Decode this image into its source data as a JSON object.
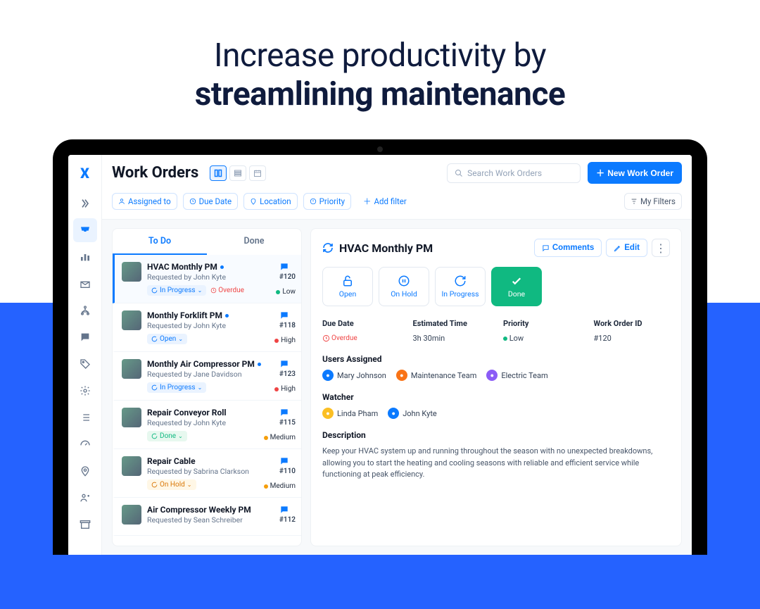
{
  "hero": {
    "line1": "Increase productivity by",
    "line2": "streamlining maintenance"
  },
  "header": {
    "title": "Work Orders",
    "search_placeholder": "Search Work Orders",
    "new_button": "New Work Order"
  },
  "filters": {
    "assigned": "Assigned to",
    "due": "Due Date",
    "location": "Location",
    "priority": "Priority",
    "add": "Add filter",
    "my": "My Filters"
  },
  "tabs": {
    "todo": "To Do",
    "done": "Done"
  },
  "work_orders": [
    {
      "title": "HVAC Monthly PM",
      "req": "Requested by John Kyte",
      "status": "In Progress",
      "status_class": "progress",
      "num": "#120",
      "prio": "Low",
      "prio_class": "prio-low",
      "overdue": true,
      "unread": true,
      "active": true
    },
    {
      "title": "Monthly Forklift PM",
      "req": "Requested by John Kyte",
      "status": "Open",
      "status_class": "open",
      "num": "#118",
      "prio": "High",
      "prio_class": "prio-high",
      "unread": true
    },
    {
      "title": "Monthly Air Compressor PM",
      "req": "Requested by Jane Davidson",
      "status": "In Progress",
      "status_class": "progress",
      "num": "#123",
      "prio": "High",
      "prio_class": "prio-high",
      "unread": true
    },
    {
      "title": "Repair Conveyor Roll",
      "req": "Requested by John Kyte",
      "status": "Done",
      "status_class": "done",
      "num": "#115",
      "prio": "Medium",
      "prio_class": "prio-med"
    },
    {
      "title": "Repair Cable",
      "req": "Requested by Sabrina Clarkson",
      "status": "On Hold",
      "status_class": "hold",
      "num": "#110",
      "prio": "Medium",
      "prio_class": "prio-med"
    },
    {
      "title": "Air Compressor Weekly PM",
      "req": "Requested by Sean Schreiber",
      "status": "",
      "status_class": "",
      "num": "#112",
      "prio": "",
      "prio_class": ""
    }
  ],
  "detail": {
    "title": "HVAC Monthly PM",
    "comments_btn": "Comments",
    "edit_btn": "Edit",
    "statuses": {
      "open": "Open",
      "hold": "On Hold",
      "progress": "In Progress",
      "done": "Done"
    },
    "labels": {
      "due": "Due Date",
      "est": "Estimated Time",
      "prio": "Priority",
      "id": "Work Order ID"
    },
    "values": {
      "due": "Overdue",
      "est": "3h 30min",
      "prio": "Low",
      "id": "#120"
    },
    "users_heading": "Users Assigned",
    "users": [
      {
        "name": "Mary Johnson",
        "cls": "av-blue"
      },
      {
        "name": "Maintenance Team",
        "cls": "av-orange"
      },
      {
        "name": "Electric Team",
        "cls": "av-purple"
      }
    ],
    "watcher_heading": "Watcher",
    "watchers": [
      {
        "name": "Linda Pham",
        "cls": "av-yellow"
      },
      {
        "name": "John Kyte",
        "cls": "av-blue"
      }
    ],
    "desc_heading": "Description",
    "desc": "Keep your HVAC system up and running throughout the season with no unexpected breakdowns, allowing you to start the heating and cooling seasons with reliable and efficient service while functioning at peak efficiency."
  },
  "overdue_label": "Overdue"
}
